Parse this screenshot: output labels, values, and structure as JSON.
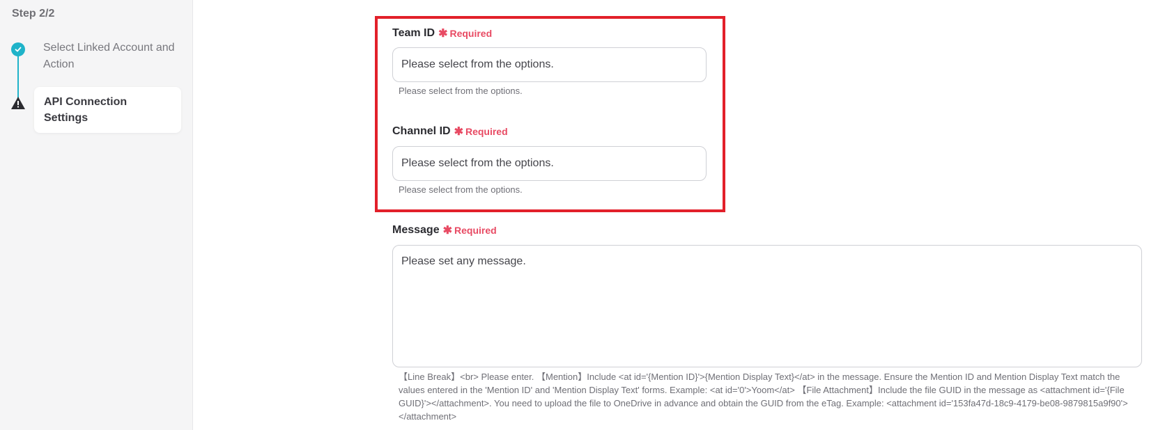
{
  "sidebar": {
    "step_label": "Step 2/2",
    "steps": [
      {
        "label": "Select Linked Account and Action",
        "status": "complete"
      },
      {
        "label": "API Connection Settings",
        "status": "warning"
      }
    ]
  },
  "form": {
    "required_text": "Required",
    "team_id": {
      "label": "Team ID",
      "placeholder": "Please select from the options.",
      "help": "Please select from the options."
    },
    "channel_id": {
      "label": "Channel ID",
      "placeholder": "Please select from the options.",
      "help": "Please select from the options."
    },
    "message": {
      "label": "Message",
      "placeholder": "Please set any message.",
      "help": "【Line Break】<br> Please enter. 【Mention】Include <at id='{Mention ID}'>{Mention Display Text}</at> in the message. Ensure the Mention ID and Mention Display Text match the values entered in the 'Mention ID' and 'Mention Display Text' forms. Example: <at id='0'>Yoom</at> 【File Attachment】Include the file GUID in the message as <attachment id='{File GUID}'></attachment>. You need to upload the file to OneDrive in advance and obtain the GUID from the eTag. Example: <attachment id='153fa47d-18c9-4179-be08-9879815a9f90'></attachment>"
    }
  },
  "colors": {
    "accent_teal": "#1fb3c9",
    "required_red": "#e84a63",
    "highlight_red": "#e2202a"
  }
}
